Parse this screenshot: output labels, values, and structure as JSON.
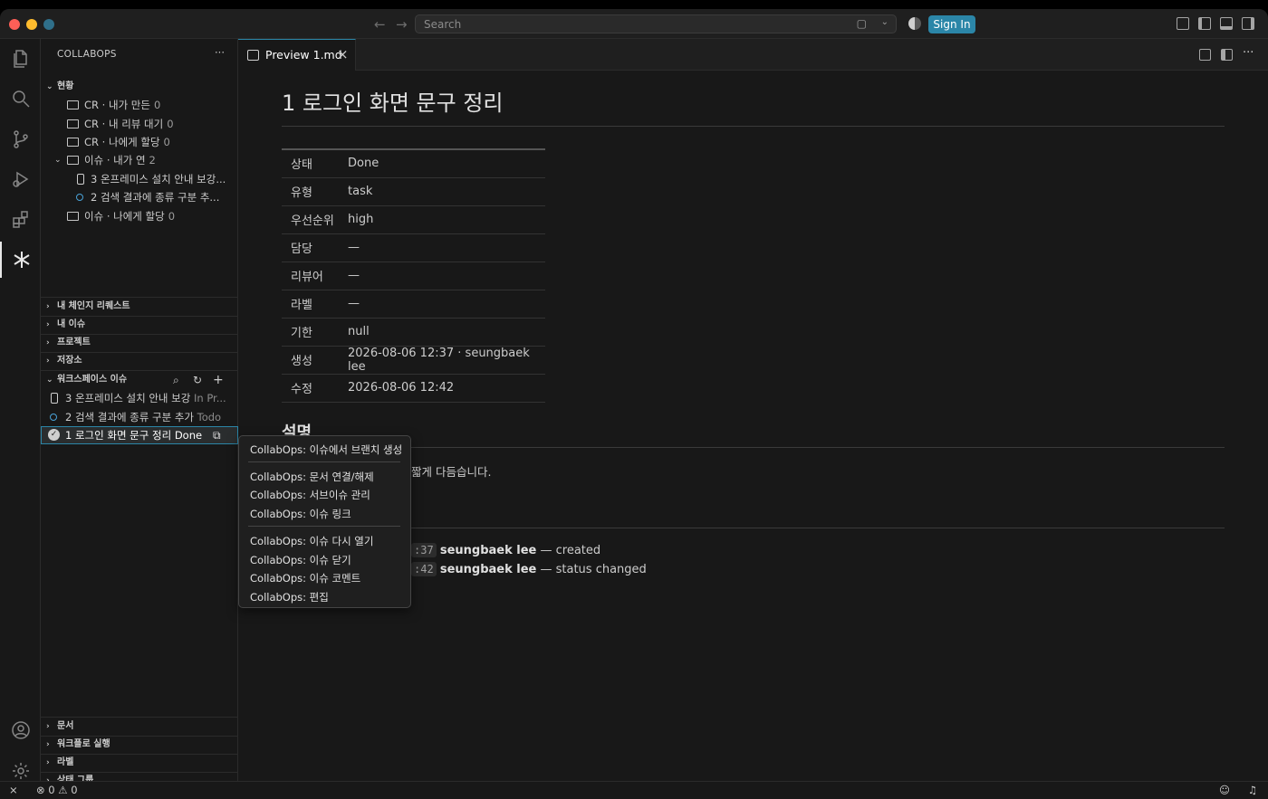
{
  "titlebar": {
    "search_placeholder": "Search",
    "sign_in": "Sign In"
  },
  "sidebar": {
    "title": "COLLABOPS",
    "more": "···",
    "status_section": "현황",
    "tree": [
      {
        "label": "CR · 내가 만든",
        "count": "0"
      },
      {
        "label": "CR · 내 리뷰 대기",
        "count": "0"
      },
      {
        "label": "CR · 나에게 할당",
        "count": "0"
      },
      {
        "label": "이슈 · 내가 연",
        "count": "2"
      },
      {
        "label": "3 온프레미스 설치 안내 보강..."
      },
      {
        "label": "2 검색 결과에 종류 구분 추..."
      },
      {
        "label": "이슈 · 나에게 할당",
        "count": "0"
      }
    ],
    "sections": [
      "내 체인지 리퀘스트",
      "내 이슈",
      "프로젝트",
      "저장소"
    ],
    "workspace_section": "워크스페이스 이슈",
    "workspace_items": [
      {
        "label": "3 온프레미스 설치 안내 보강",
        "status": "In Pr..."
      },
      {
        "label": "2 검색 결과에 종류 구분 추가",
        "status": "Todo"
      },
      {
        "label": "1 로그인 화면 문구 정리",
        "status": "Done"
      }
    ],
    "bottom_sections": [
      "문서",
      "워크플로 실행",
      "라벨",
      "상태 그룹"
    ]
  },
  "editor": {
    "tab_label": "Preview 1.md",
    "title": "1 로그인 화면 문구 정리",
    "meta": [
      {
        "k": "상태",
        "v": "Done"
      },
      {
        "k": "유형",
        "v": "task"
      },
      {
        "k": "우선순위",
        "v": "high"
      },
      {
        "k": "담당",
        "v": "—"
      },
      {
        "k": "리뷰어",
        "v": "—"
      },
      {
        "k": "라벨",
        "v": "—"
      },
      {
        "k": "기한",
        "v": "null"
      },
      {
        "k": "생성",
        "v": "2026-08-06 12:37 · seungbaek lee"
      },
      {
        "k": "수정",
        "v": "2026-08-06 12:42"
      }
    ],
    "description_heading": "설명",
    "description_fragment": "짧게 다듬습니다.",
    "activity": [
      {
        "time": ":37",
        "user": "seungbaek lee",
        "action": " — created"
      },
      {
        "time": ":42",
        "user": "seungbaek lee",
        "action": " — status changed"
      }
    ]
  },
  "context_menu": {
    "groups": [
      [
        "CollabOps: 이슈에서 브랜치 생성"
      ],
      [
        "CollabOps: 문서 연결/해제",
        "CollabOps: 서브이슈 관리",
        "CollabOps: 이슈 링크"
      ],
      [
        "CollabOps: 이슈 다시 열기",
        "CollabOps: 이슈 닫기",
        "CollabOps: 이슈 코멘트",
        "CollabOps: 편집"
      ]
    ]
  },
  "statusbar": {
    "errors": "0",
    "warnings": "0"
  },
  "colors": {
    "accent": "#2b86a8",
    "background": "#181818",
    "selection_outline": "#2b86a8"
  }
}
